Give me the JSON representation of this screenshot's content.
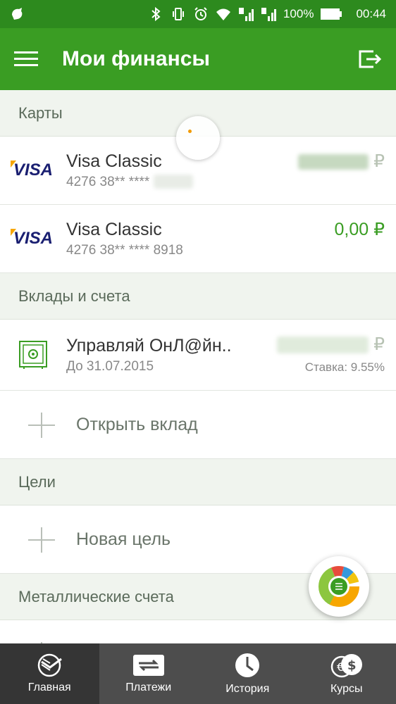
{
  "status": {
    "battery": "100%",
    "time": "00:44"
  },
  "appbar": {
    "title": "Мои финансы"
  },
  "sections": {
    "cards": "Карты",
    "deposits": "Вклады и счета",
    "goals": "Цели",
    "metal": "Металлические счета"
  },
  "cards": [
    {
      "brand": "VISA",
      "name": "Visa Classic",
      "number": "4276 38** ****",
      "amount": "",
      "currency": "₽"
    },
    {
      "brand": "VISA",
      "name": "Visa Classic",
      "number": "4276 38** **** 8918",
      "amount": "0,00",
      "currency": "₽"
    }
  ],
  "deposit": {
    "name": "Управляй ОнЛ@йн..",
    "until": "До 31.07.2015",
    "currency": "₽",
    "rate": "Ставка: 9.55%"
  },
  "actions": {
    "open_deposit": "Открыть вклад",
    "new_goal": "Новая цель"
  },
  "nav": [
    {
      "label": "Главная",
      "icon": "sber-logo-icon"
    },
    {
      "label": "Платежи",
      "icon": "payments-icon"
    },
    {
      "label": "История",
      "icon": "clock-icon"
    },
    {
      "label": "Курсы",
      "icon": "currency-icon"
    }
  ],
  "colors": {
    "primary": "#3a9d23",
    "statusbar": "#2d8a1e",
    "nav_bg": "#4d4d4d",
    "amount": "#3a9d23"
  }
}
